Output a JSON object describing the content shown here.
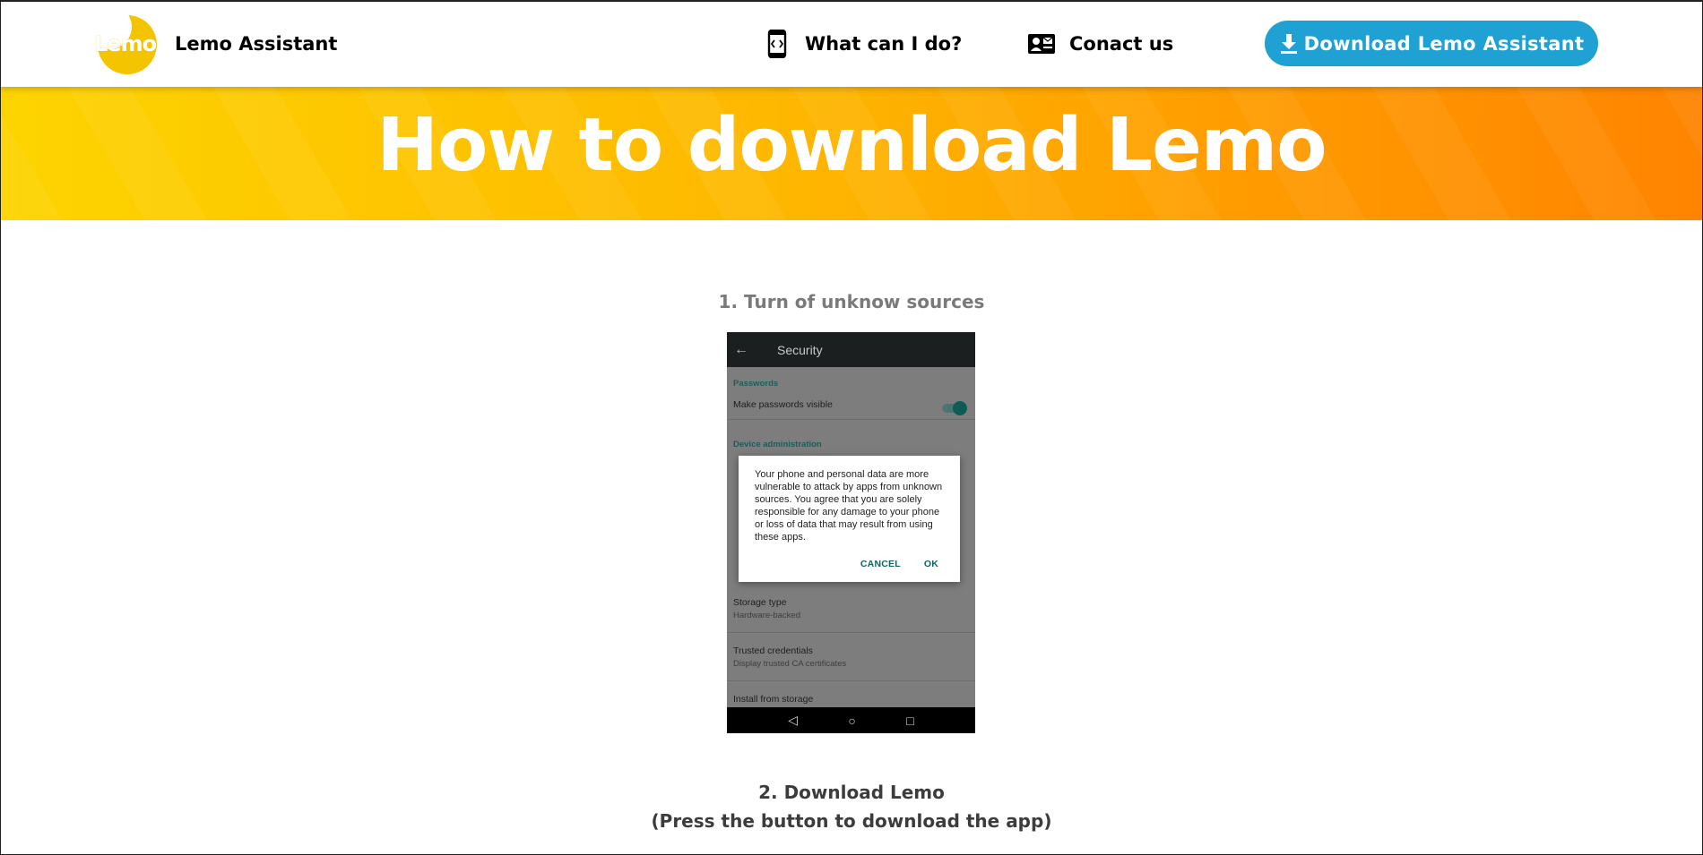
{
  "header": {
    "logo_text": "Lemo",
    "brand_name": "Lemo Assistant",
    "nav": [
      {
        "label": "What can I do?",
        "icon": "phone-code-icon"
      },
      {
        "label": "Conact us",
        "icon": "contact-card-icon"
      }
    ],
    "download_button": {
      "label": "Download Lemo Assistant",
      "icon": "download-icon",
      "color": "#1fa1d3"
    }
  },
  "hero": {
    "title": "How to download Lemo",
    "gradient_colors": [
      "#fdd400",
      "#ff8400"
    ]
  },
  "steps": {
    "step1_title": "1. Turn of unknow sources",
    "step2_title": "2. Download Lemo",
    "step2_subtitle": "(Press the button to download the app)"
  },
  "phone": {
    "screen_title": "Security",
    "section_passwords": "Passwords",
    "make_passwords_visible": "Make passwords visible",
    "section_device_admin": "Device administration",
    "storage_type": "Storage type",
    "storage_type_value": "Hardware-backed",
    "trusted_credentials": "Trusted credentials",
    "trusted_credentials_sub": "Display trusted CA certificates",
    "install_from_storage": "Install from storage",
    "dialog": {
      "message": "Your phone and personal data are more vulnerable to attack by apps from unknown sources. You agree that you are solely responsible for any damage to your phone or loss of data that may result from using these apps.",
      "cancel": "CANCEL",
      "ok": "OK"
    }
  }
}
